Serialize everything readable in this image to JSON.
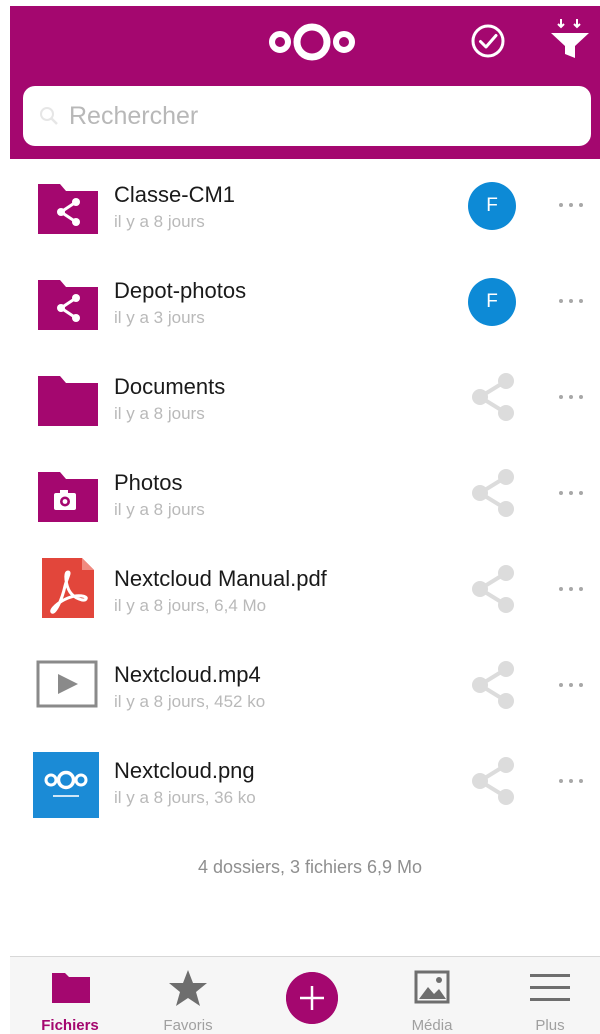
{
  "colors": {
    "brand": "#a4076f",
    "avatar": "#0d8ad6",
    "pdf": "#e2463b",
    "image": "#1b8bd6"
  },
  "search": {
    "placeholder": "Rechercher"
  },
  "files": [
    {
      "name": "Classe-CM1",
      "meta": "il y a 8 jours",
      "icon": "shared-folder-icon",
      "owner_initial": "F"
    },
    {
      "name": "Depot-photos",
      "meta": "il y a 3 jours",
      "icon": "shared-folder-icon",
      "owner_initial": "F"
    },
    {
      "name": "Documents",
      "meta": "il y a 8 jours",
      "icon": "folder-icon"
    },
    {
      "name": "Photos",
      "meta": "il y a 8 jours",
      "icon": "photo-folder-icon"
    },
    {
      "name": "Nextcloud Manual.pdf",
      "meta": "il y a 8 jours, 6,4 Mo",
      "icon": "pdf-icon"
    },
    {
      "name": "Nextcloud.mp4",
      "meta": "il y a 8 jours, 452 ko",
      "icon": "video-icon"
    },
    {
      "name": "Nextcloud.png",
      "meta": "il y a 8 jours, 36 ko",
      "icon": "image-thumbnail"
    }
  ],
  "summary": "4 dossiers, 3 fichiers 6,9 Mo",
  "tabs": {
    "files": "Fichiers",
    "favorites": "Favoris",
    "media": "Média",
    "more": "Plus"
  }
}
